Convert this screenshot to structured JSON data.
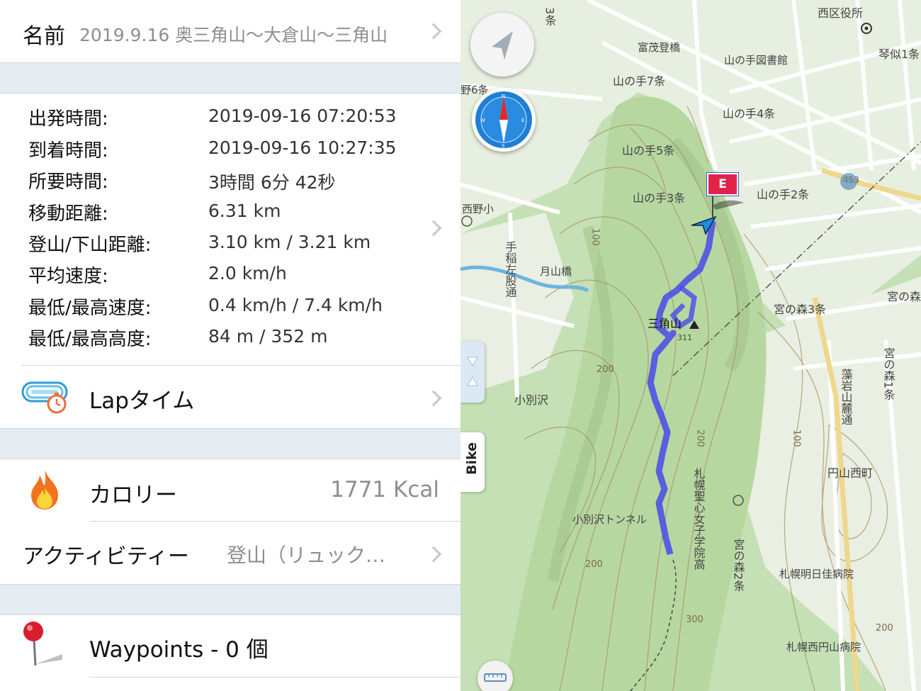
{
  "name": {
    "label": "名前",
    "value": "2019.9.16 奥三角山〜大倉山〜三角山"
  },
  "stats": [
    {
      "label": "出発時間:",
      "value": "2019-09-16 07:20:53"
    },
    {
      "label": "到着時間:",
      "value": "2019-09-16 10:27:35"
    },
    {
      "label": "所要時間:",
      "value": "3時間 6分 42秒"
    },
    {
      "label": "移動距離:",
      "value": "6.31 km"
    },
    {
      "label": "登山/下山距離:",
      "value": "3.10 km / 3.21 km"
    },
    {
      "label": "平均速度:",
      "value": "2.0 km/h"
    },
    {
      "label": "最低/最高速度:",
      "value": "0.4 km/h / 7.4 km/h"
    },
    {
      "label": "最低/最高高度:",
      "value": "84 m / 352 m"
    }
  ],
  "lap": {
    "label": "Lapタイム",
    "icon": "stopwatch-track-icon"
  },
  "calorie": {
    "label": "カロリー",
    "value": "1771 Kcal",
    "icon": "flame-icon"
  },
  "activity": {
    "label": "アクティビティー",
    "value": "登山（リュック…"
  },
  "waypoints": {
    "label": "Waypoints - 0 個",
    "icon": "pin-icon"
  },
  "map": {
    "bike_tab": "Bike",
    "end_marker": "E",
    "route_color": "#4a4aea",
    "labels": {
      "ward_office": "西区役所",
      "library": "山の手図書館",
      "kotoni": "琴似1条",
      "tomoshigebashi": "富茂登橋",
      "yamanote7": "山の手7条",
      "yamanote4": "山の手4条",
      "yamanote5": "山の手5条",
      "yamanote3": "山の手3条",
      "yamanote2": "山の手2条",
      "nishinosho": "西野小",
      "teine_road": "手稲左股通",
      "tsukiyamabashi": "月山橋",
      "sankakuyama": "三角山",
      "sankakuyama_alt": "311",
      "miyanomori3": "宮の森3条",
      "miyanomori_partial": "宮の森",
      "miyanomori1": "宮の森1条",
      "fujiyama_road": "藻岩山麓通",
      "kobetsuzawa": "小別沢",
      "school": "札幌聖心女子学院高",
      "tunnel": "小別沢トンネル",
      "maruyama_nishi": "円山西町",
      "miyanomori2": "宮の森2条",
      "meikei_hospital": "札幌明日佳病院",
      "nishimaruyama_hospital": "札幌西円山病院",
      "noboru_6": "野6条",
      "sanjo": "3条",
      "route453": "453",
      "c100a": "100",
      "c100b": "100",
      "c200a": "200",
      "c200b": "200",
      "c200c": "200",
      "c200d": "200",
      "c300": "300"
    }
  }
}
